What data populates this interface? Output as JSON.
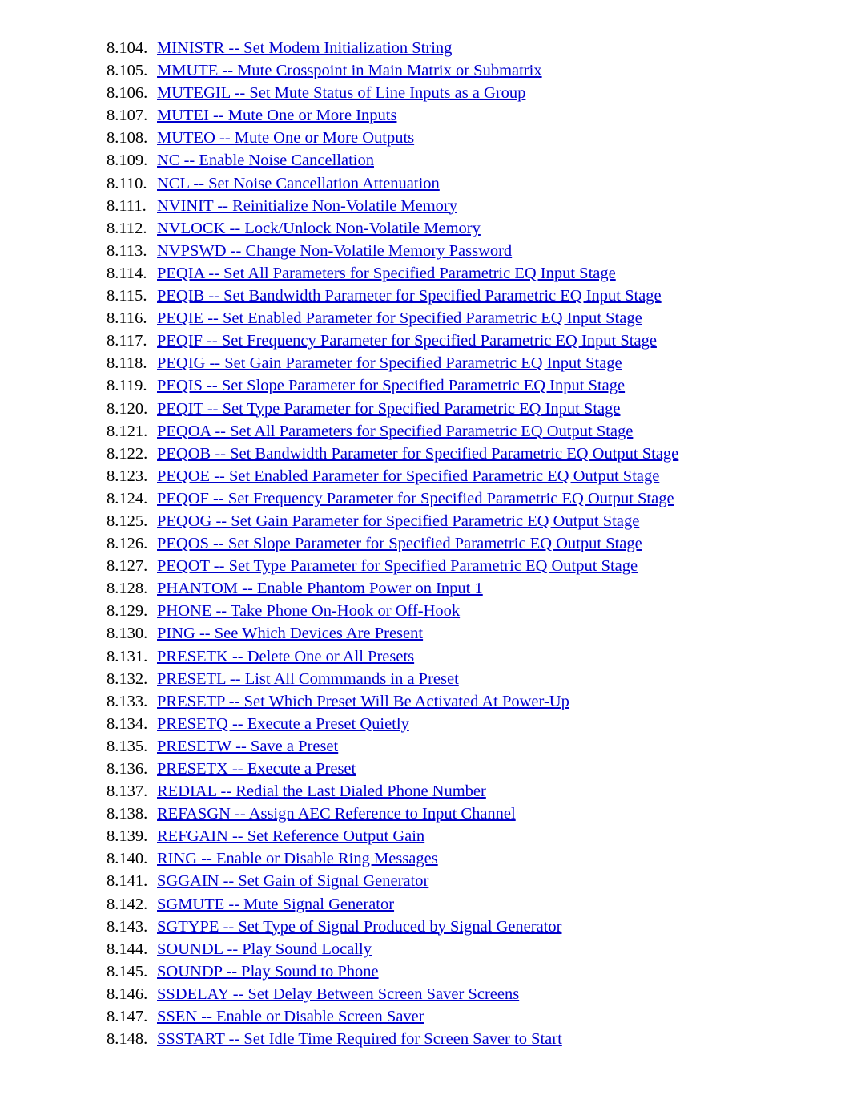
{
  "document": {
    "section": "8",
    "background_color": "#ffffff",
    "link_color": "#0000cc",
    "number_color": "#000000"
  },
  "toc": {
    "entries": [
      {
        "number": "8.104.",
        "label": "MINISTR -- Set Modem Initialization String"
      },
      {
        "number": "8.105.",
        "label": "MMUTE -- Mute Crosspoint in Main Matrix or Submatrix"
      },
      {
        "number": "8.106.",
        "label": "MUTEGIL -- Set Mute Status of Line Inputs as a Group"
      },
      {
        "number": "8.107.",
        "label": "MUTEI -- Mute One or More Inputs"
      },
      {
        "number": "8.108.",
        "label": "MUTEO -- Mute One or More Outputs"
      },
      {
        "number": "8.109.",
        "label": "NC -- Enable Noise Cancellation"
      },
      {
        "number": "8.110.",
        "label": "NCL -- Set Noise Cancellation Attenuation"
      },
      {
        "number": "8.111.",
        "label": "NVINIT -- Reinitialize Non-Volatile Memory"
      },
      {
        "number": "8.112.",
        "label": "NVLOCK -- Lock/Unlock Non-Volatile Memory"
      },
      {
        "number": "8.113.",
        "label": "NVPSWD -- Change Non-Volatile Memory Password"
      },
      {
        "number": "8.114.",
        "label": "PEQIA -- Set All Parameters for Specified Parametric EQ Input Stage"
      },
      {
        "number": "8.115.",
        "label": "PEQIB -- Set Bandwidth Parameter for Specified Parametric EQ Input Stage"
      },
      {
        "number": "8.116.",
        "label": "PEQIE -- Set Enabled Parameter for Specified Parametric EQ Input Stage"
      },
      {
        "number": "8.117.",
        "label": "PEQIF -- Set Frequency Parameter for Specified Parametric EQ Input Stage"
      },
      {
        "number": "8.118.",
        "label": "PEQIG -- Set Gain Parameter for Specified Parametric EQ Input Stage"
      },
      {
        "number": "8.119.",
        "label": "PEQIS -- Set Slope Parameter for Specified Parametric EQ Input Stage"
      },
      {
        "number": "8.120.",
        "label": "PEQIT -- Set Type Parameter for Specified Parametric EQ Input Stage"
      },
      {
        "number": "8.121.",
        "label": "PEQOA -- Set All Parameters for Specified Parametric EQ Output Stage"
      },
      {
        "number": "8.122.",
        "label": "PEQOB -- Set Bandwidth Parameter for Specified Parametric EQ Output Stage"
      },
      {
        "number": "8.123.",
        "label": "PEQOE -- Set Enabled Parameter for Specified Parametric EQ Output Stage"
      },
      {
        "number": "8.124.",
        "label": "PEQOF -- Set Frequency Parameter for Specified Parametric EQ Output Stage"
      },
      {
        "number": "8.125.",
        "label": "PEQOG -- Set Gain Parameter for Specified Parametric EQ Output Stage"
      },
      {
        "number": "8.126.",
        "label": "PEQOS -- Set Slope Parameter for Specified Parametric EQ Output Stage"
      },
      {
        "number": "8.127.",
        "label": "PEQOT -- Set Type Parameter for Specified Parametric EQ Output Stage"
      },
      {
        "number": "8.128.",
        "label": "PHANTOM -- Enable Phantom Power on Input 1"
      },
      {
        "number": "8.129.",
        "label": "PHONE -- Take Phone On-Hook or Off-Hook"
      },
      {
        "number": "8.130.",
        "label": "PING -- See Which Devices Are Present"
      },
      {
        "number": "8.131.",
        "label": "PRESETK -- Delete One or All Presets"
      },
      {
        "number": "8.132.",
        "label": "PRESETL -- List All Commmands in a Preset"
      },
      {
        "number": "8.133.",
        "label": "PRESETP -- Set Which Preset Will Be Activated At Power-Up"
      },
      {
        "number": "8.134.",
        "label": "PRESETQ -- Execute a Preset Quietly"
      },
      {
        "number": "8.135.",
        "label": "PRESETW -- Save a Preset"
      },
      {
        "number": "8.136.",
        "label": "PRESETX -- Execute a Preset"
      },
      {
        "number": "8.137.",
        "label": "REDIAL -- Redial the Last Dialed Phone Number"
      },
      {
        "number": "8.138.",
        "label": "REFASGN -- Assign AEC Reference to Input Channel"
      },
      {
        "number": "8.139.",
        "label": "REFGAIN -- Set Reference Output Gain"
      },
      {
        "number": "8.140.",
        "label": "RING -- Enable or Disable Ring Messages"
      },
      {
        "number": "8.141.",
        "label": "SGGAIN -- Set Gain of Signal Generator"
      },
      {
        "number": "8.142.",
        "label": "SGMUTE -- Mute Signal Generator"
      },
      {
        "number": "8.143.",
        "label": "SGTYPE -- Set Type of Signal Produced by Signal Generator"
      },
      {
        "number": "8.144.",
        "label": "SOUNDL -- Play Sound Locally"
      },
      {
        "number": "8.145.",
        "label": "SOUNDP -- Play Sound to Phone"
      },
      {
        "number": "8.146.",
        "label": "SSDELAY -- Set Delay Between Screen Saver Screens"
      },
      {
        "number": "8.147.",
        "label": "SSEN -- Enable or Disable Screen Saver"
      },
      {
        "number": "8.148.",
        "label": "SSSTART -- Set Idle Time Required for Screen Saver to Start"
      }
    ]
  }
}
